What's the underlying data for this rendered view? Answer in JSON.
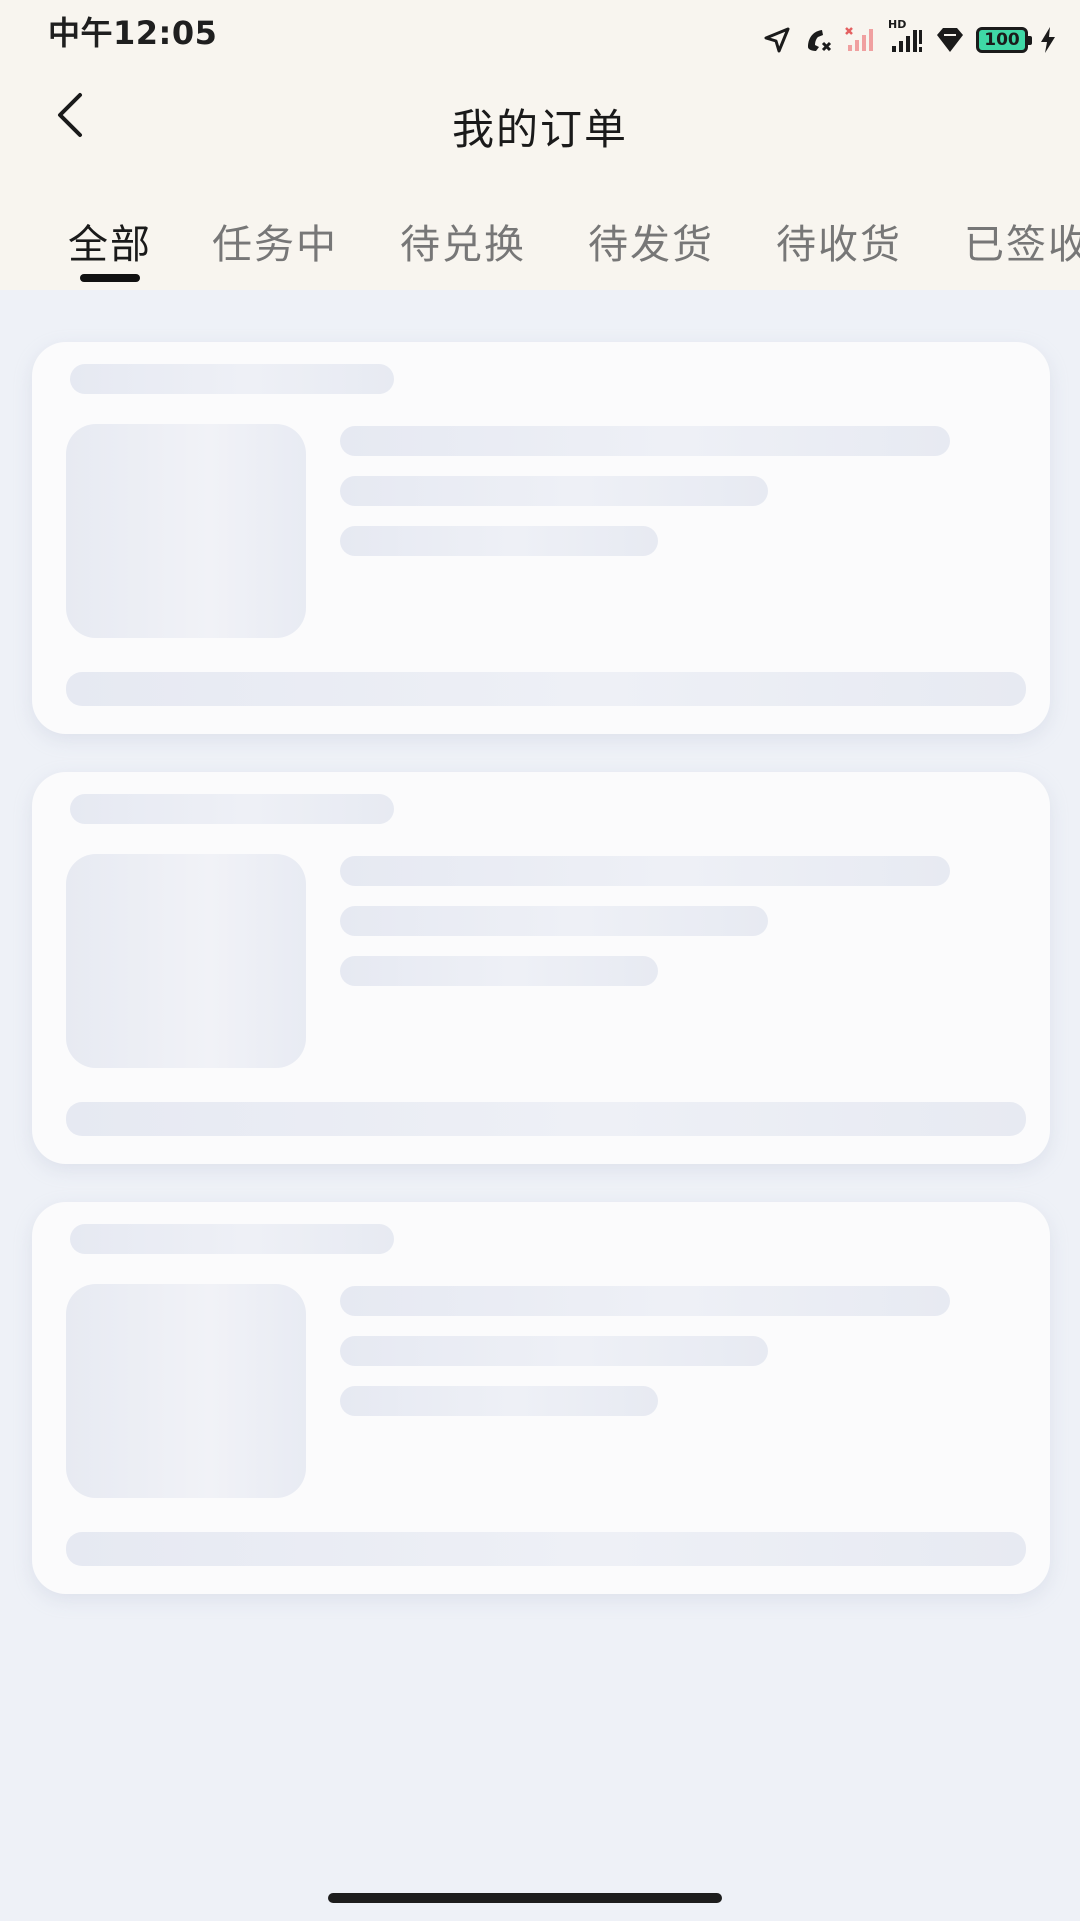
{
  "status_bar": {
    "time": "中午12:05",
    "battery_level": "100",
    "icons": [
      "location-arrow-icon",
      "call-missed-icon",
      "signal-no-sim-icon",
      "signal-hd-icon",
      "vpn-diamond-icon",
      "battery-icon",
      "charging-bolt-icon"
    ],
    "hd_label": "HD"
  },
  "header": {
    "title": "我的订单",
    "back_icon": "chevron-left-icon"
  },
  "tabs": [
    {
      "label": "全部",
      "active": true
    },
    {
      "label": "任务中",
      "active": false
    },
    {
      "label": "待兑换",
      "active": false
    },
    {
      "label": "待发货",
      "active": false
    },
    {
      "label": "待收货",
      "active": false
    },
    {
      "label": "已签收",
      "active": false
    }
  ],
  "content": {
    "state": "loading-skeleton",
    "placeholder_cards": 3
  },
  "colors": {
    "header_bg": "#f8f5ef",
    "page_bg": "#eef1f7",
    "card_bg": "#fbfbfc",
    "skeleton": "#e6e9f2",
    "battery_fill": "#3fd8a6"
  }
}
